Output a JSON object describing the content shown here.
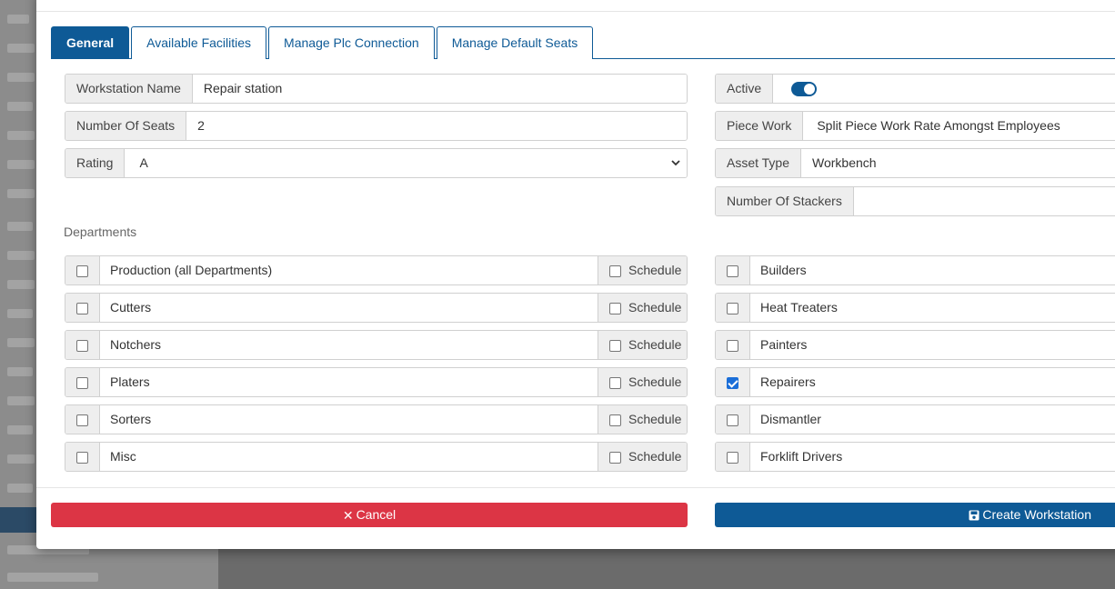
{
  "tabs": [
    {
      "label": "General",
      "active": true
    },
    {
      "label": "Available Facilities",
      "active": false
    },
    {
      "label": "Manage Plc Connection",
      "active": false
    },
    {
      "label": "Manage Default Seats",
      "active": false
    }
  ],
  "left_fields": {
    "workstation_name": {
      "label": "Workstation Name",
      "value": "Repair station"
    },
    "number_of_seats": {
      "label": "Number Of Seats",
      "value": "2"
    },
    "rating": {
      "label": "Rating",
      "value": "A"
    }
  },
  "right_fields": {
    "active": {
      "label": "Active",
      "value": true
    },
    "piece_work": {
      "label": "Piece Work",
      "value": "Split Piece Work Rate Amongst Employees"
    },
    "asset_type": {
      "label": "Asset Type",
      "value": "Workbench"
    },
    "number_of_stackers": {
      "label": "Number Of Stackers",
      "value": ""
    }
  },
  "departments_label": "Departments",
  "schedule_label": "Schedule",
  "departments_left": [
    {
      "name": "Production (all Departments)",
      "checked": false,
      "schedule": false
    },
    {
      "name": "Cutters",
      "checked": false,
      "schedule": false
    },
    {
      "name": "Notchers",
      "checked": false,
      "schedule": false
    },
    {
      "name": "Platers",
      "checked": false,
      "schedule": false
    },
    {
      "name": "Sorters",
      "checked": false,
      "schedule": false
    },
    {
      "name": "Misc",
      "checked": false,
      "schedule": false
    }
  ],
  "departments_right": [
    {
      "name": "Builders",
      "checked": false
    },
    {
      "name": "Heat Treaters",
      "checked": false
    },
    {
      "name": "Painters",
      "checked": false
    },
    {
      "name": "Repairers",
      "checked": true
    },
    {
      "name": "Dismantler",
      "checked": false
    },
    {
      "name": "Forklift Drivers",
      "checked": false
    }
  ],
  "buttons": {
    "cancel": {
      "label": "Cancel",
      "icon": "close-icon",
      "color": "#dc3545"
    },
    "create": {
      "label": "Create Workstation",
      "icon": "save-icon",
      "color": "#0e5a96"
    }
  },
  "colors": {
    "primary": "#0e5a96",
    "danger": "#dc3545",
    "checkbox_checked": "#1a6ed8"
  }
}
